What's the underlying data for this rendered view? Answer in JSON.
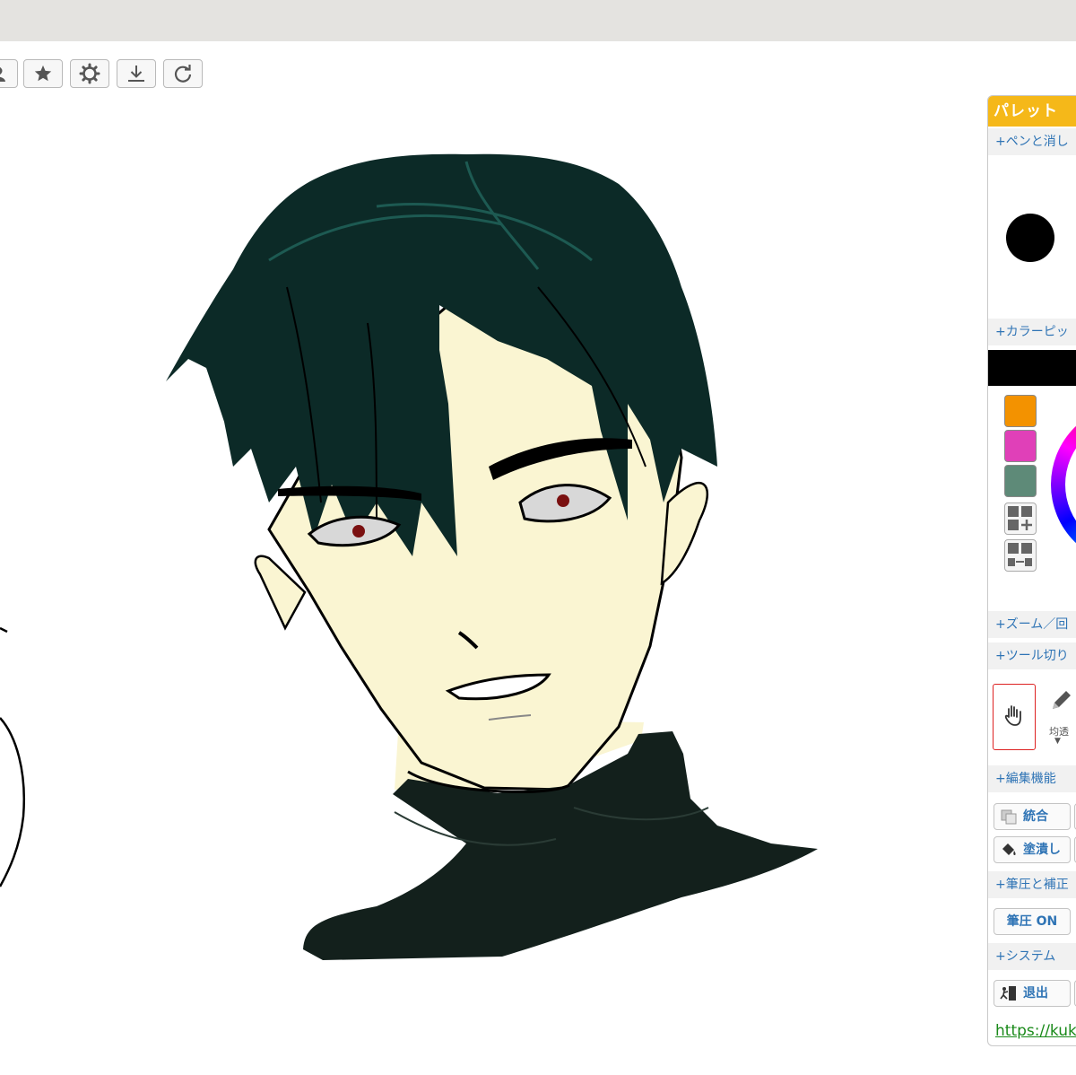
{
  "palette": {
    "title": "パレット",
    "sections": {
      "pen": "+ペンと消し",
      "color_picker": "+カラーピッ",
      "zoom": "+ズーム／回",
      "tool_switch": "+ツール切り",
      "edit": "+編集機能",
      "pressure": "+筆圧と補正",
      "system": "+システム"
    },
    "swatches": [
      "#f39200",
      "#e040b8",
      "#5e8a78"
    ],
    "current_color": "#000000",
    "tool_label": "均透",
    "tool_arrow": "▼",
    "buttons": {
      "merge": "統合",
      "fill": "塗潰し",
      "pressure_on": "筆圧 ON",
      "exit": "退出"
    },
    "link": "https://kuk"
  },
  "icons": {
    "toolbar": [
      "user-icon",
      "star-icon",
      "gear-icon",
      "download-icon",
      "redo-icon"
    ]
  }
}
